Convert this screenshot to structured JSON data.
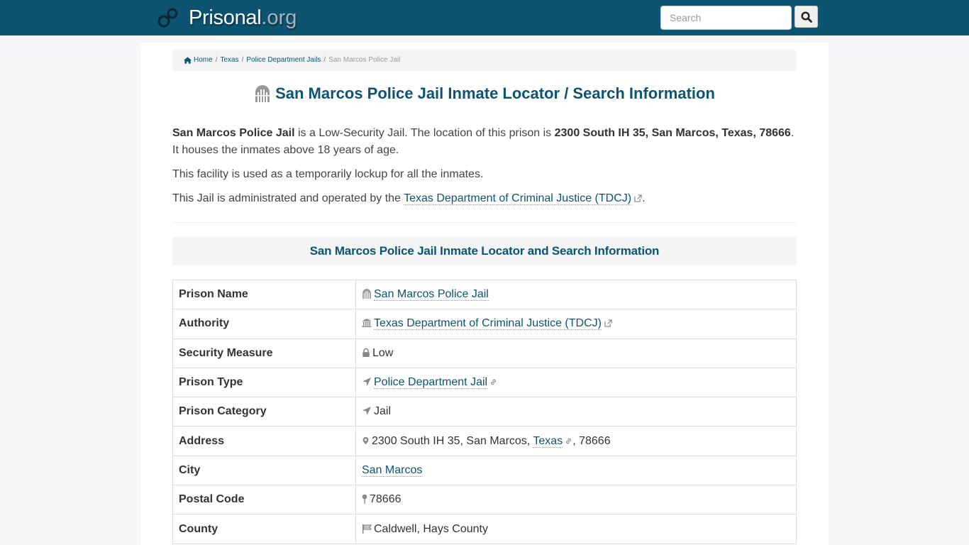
{
  "navbar": {
    "brand_name": "Prisonal",
    "brand_tld": ".org",
    "search_placeholder": "Search",
    "search_value": ""
  },
  "breadcrumb": {
    "items": [
      "Home",
      "Texas",
      "Police Department Jails"
    ],
    "current": "San Marcos Police Jail",
    "separator": "/"
  },
  "page": {
    "title": "San Marcos Police Jail Inmate Locator / Search Information"
  },
  "intro": {
    "p1_name": "San Marcos Police Jail",
    "p1_mid": " is a Low-Security Jail. The location of this prison is ",
    "p1_address": "2300 South IH 35, San Marcos, Texas, 78666",
    "p1_end": ". It houses the inmates above 18 years of age.",
    "p2": "This facility is used as a temporarily lockup for all the inmates.",
    "p3_start": "This Jail is administrated and operated by the ",
    "p3_link": "Texas Department of Criminal Justice (TDCJ)",
    "p3_end": "."
  },
  "section": {
    "heading": "San Marcos Police Jail Inmate Locator and Search Information"
  },
  "table": {
    "rows": [
      {
        "label": "Prison Name",
        "value": "San Marcos Police Jail",
        "icon": "prison-icon"
      },
      {
        "label": "Authority",
        "value": "Texas Department of Criminal Justice (TDCJ)",
        "icon": "bank-icon"
      },
      {
        "label": "Security Measure",
        "value": "Low",
        "icon": "lock-icon"
      },
      {
        "label": "Prison Type",
        "value": "Police Department Jail",
        "icon": "location-arrow-icon"
      },
      {
        "label": "Prison Category",
        "value": "Jail",
        "icon": "location-arrow-icon"
      },
      {
        "label": "Address",
        "value_street": "2300 South IH 35, San Marcos, ",
        "value_state": "Texas",
        "value_zip": ", 78666",
        "icon": "map-marker-icon"
      },
      {
        "label": "City",
        "value": "San Marcos"
      },
      {
        "label": "Postal Code",
        "value": "78666",
        "icon": "map-pin-icon"
      },
      {
        "label": "County",
        "value": "Caldwell, Hays County",
        "icon": "flag-icon"
      }
    ]
  },
  "colors": {
    "brand": "#0c5471",
    "icon_gray": "#888888"
  }
}
